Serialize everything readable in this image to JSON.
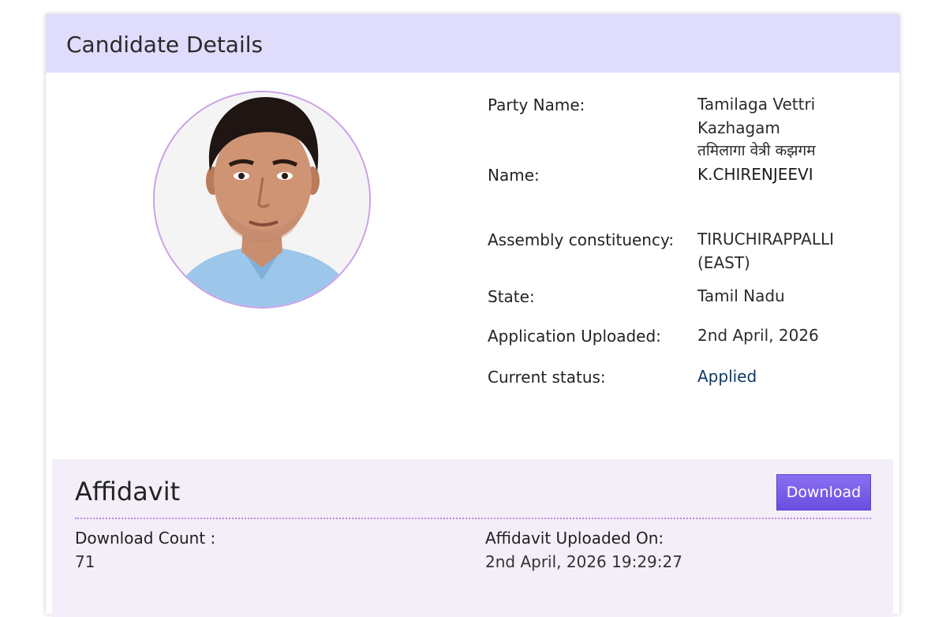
{
  "header": {
    "title": "Candidate Details"
  },
  "candidate": {
    "photo_alt": "",
    "fields": {
      "party_label": "Party Name:",
      "party_value_line1": "Tamilaga Vettri",
      "party_value_line2": "Kazhagam",
      "party_value_line3": "तमिलागा वेत्री कझगम",
      "name_label": "Name:",
      "name_value": "K.CHIRENJEEVI",
      "constituency_label": "Assembly constituency:",
      "constituency_value_line1": "TIRUCHIRAPPALLI",
      "constituency_value_line2": "(EAST)",
      "state_label": "State:",
      "state_value": "Tamil Nadu",
      "uploaded_label": "Application Uploaded:",
      "uploaded_value": "2nd April, 2026",
      "status_label": "Current status:",
      "status_value": "Applied"
    }
  },
  "affidavit": {
    "title": "Affidavit",
    "download_label": "Download",
    "download_count_label": "Download Count :",
    "download_count_value": "71",
    "uploaded_on_label": "Affidavit Uploaded On:",
    "uploaded_on_value": "2nd April, 2026 19:29:27"
  },
  "colors": {
    "header_bg": "#e0dcfc",
    "affidavit_bg": "#f3eef8",
    "button": "#7a5ee8",
    "status": "#0d3b66",
    "photo_ring": "#c9a0e6"
  }
}
